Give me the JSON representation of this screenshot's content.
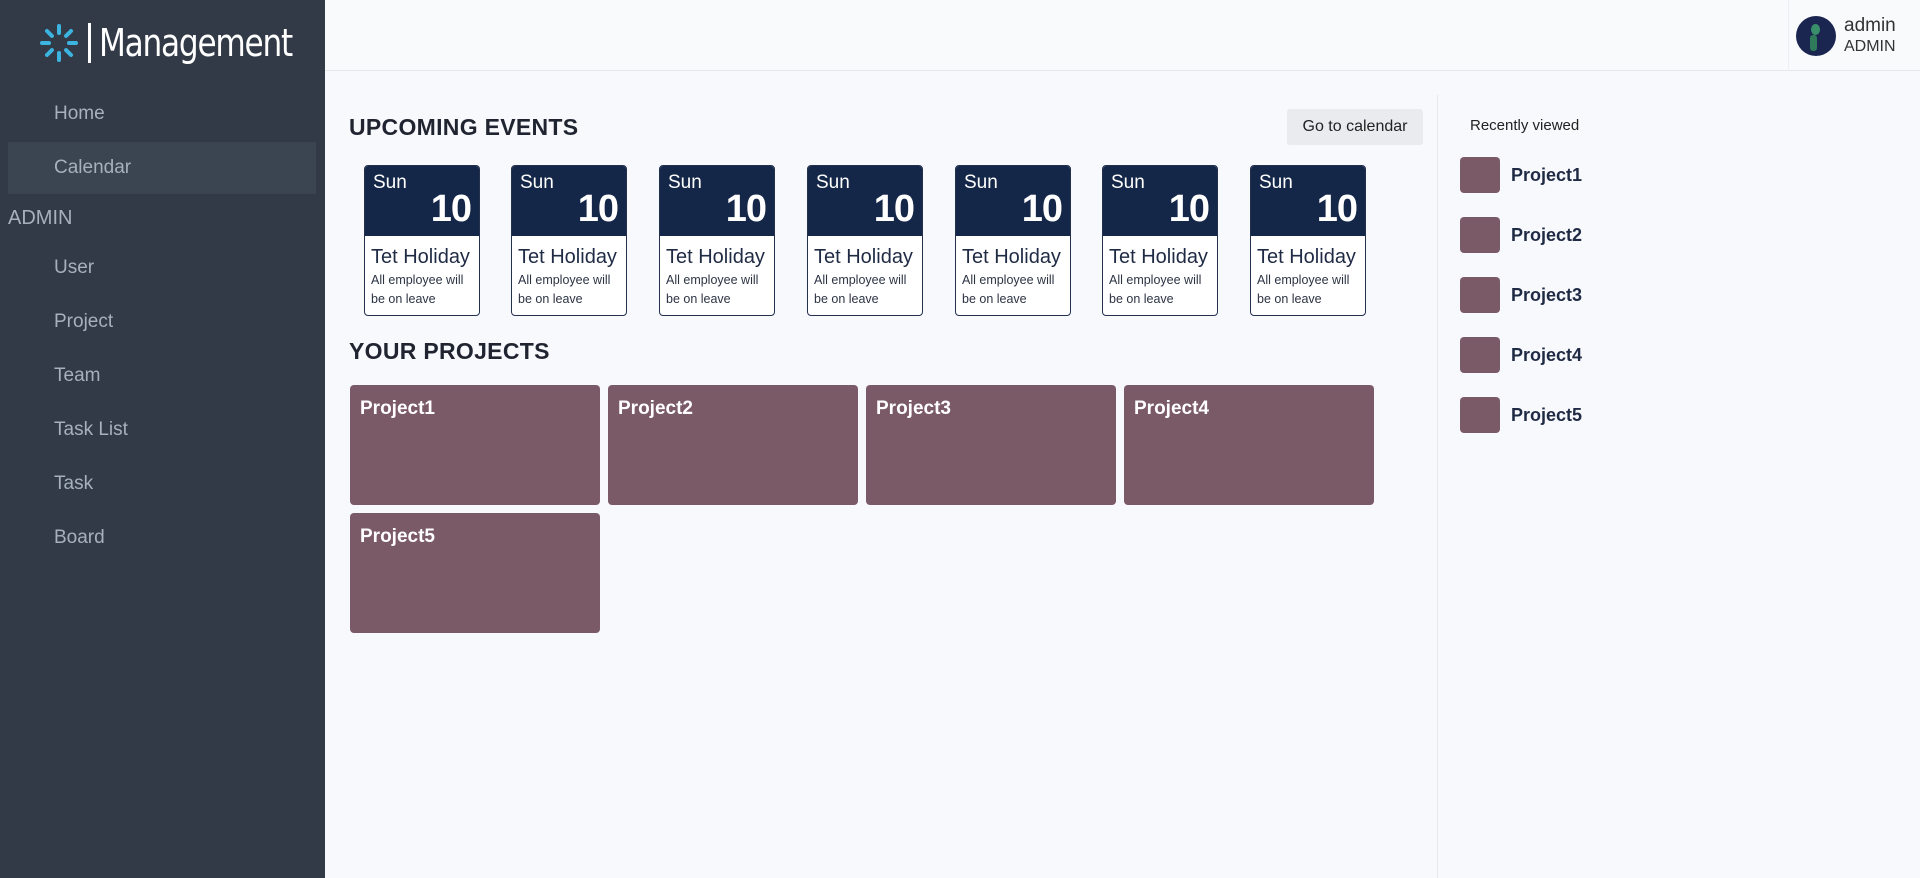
{
  "app": {
    "title": "Management"
  },
  "colors": {
    "sidebar": "#323a47",
    "event_header": "#152748",
    "project": "#7b5a68",
    "brand_accent": "#3cb4e0"
  },
  "sidebar": {
    "items": [
      {
        "label": "Home",
        "active": false
      },
      {
        "label": "Calendar",
        "active": true
      }
    ],
    "admin_section": "ADMIN",
    "admin_items": [
      {
        "label": "User"
      },
      {
        "label": "Project"
      },
      {
        "label": "Team"
      },
      {
        "label": "Task List"
      },
      {
        "label": "Task"
      },
      {
        "label": "Board"
      }
    ]
  },
  "user": {
    "name": "admin",
    "role": "ADMIN"
  },
  "events": {
    "title": "UPCOMING EVENTS",
    "button": "Go to calendar",
    "items": [
      {
        "day": "Sun",
        "date": "10",
        "title": "Tet Holiday",
        "desc": "All employee will be on leave"
      },
      {
        "day": "Sun",
        "date": "10",
        "title": "Tet Holiday",
        "desc": "All employee will be on leave"
      },
      {
        "day": "Sun",
        "date": "10",
        "title": "Tet Holiday",
        "desc": "All employee will be on leave"
      },
      {
        "day": "Sun",
        "date": "10",
        "title": "Tet Holiday",
        "desc": "All employee will be on leave"
      },
      {
        "day": "Sun",
        "date": "10",
        "title": "Tet Holiday",
        "desc": "All employee will be on leave"
      },
      {
        "day": "Sun",
        "date": "10",
        "title": "Tet Holiday",
        "desc": "All employee will be on leave"
      },
      {
        "day": "Sun",
        "date": "10",
        "title": "Tet Holiday",
        "desc": "All employee will be on leave"
      }
    ]
  },
  "projects": {
    "title": "YOUR PROJECTS",
    "items": [
      {
        "name": "Project1"
      },
      {
        "name": "Project2"
      },
      {
        "name": "Project3"
      },
      {
        "name": "Project4"
      },
      {
        "name": "Project5"
      }
    ]
  },
  "recently_viewed": {
    "title": "Recently viewed",
    "items": [
      {
        "name": "Project1"
      },
      {
        "name": "Project2"
      },
      {
        "name": "Project3"
      },
      {
        "name": "Project4"
      },
      {
        "name": "Project5"
      }
    ]
  }
}
